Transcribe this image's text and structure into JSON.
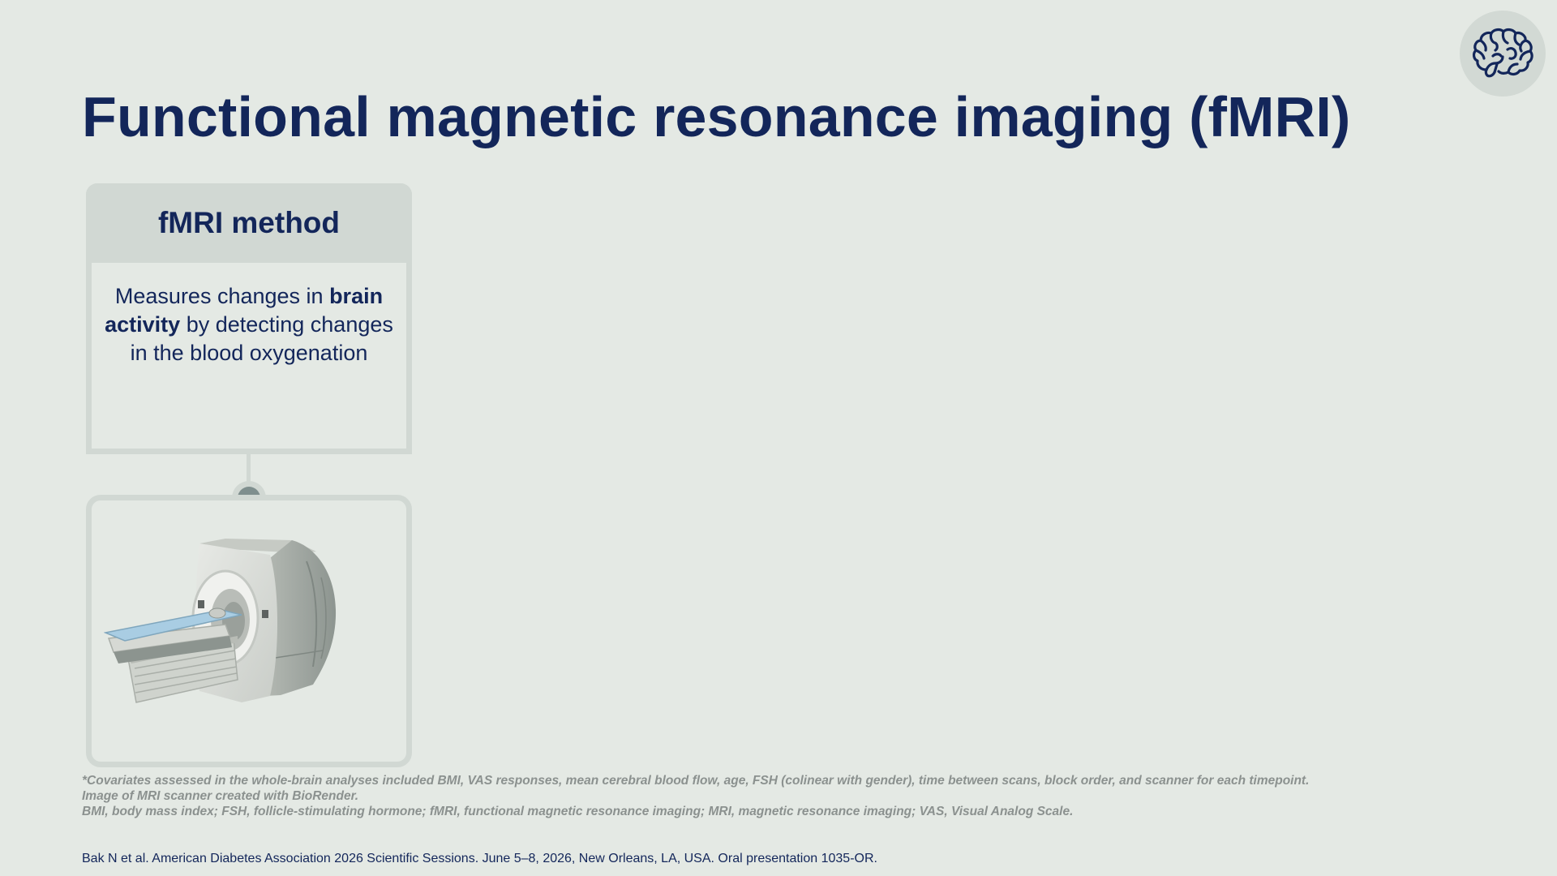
{
  "slide": {
    "title": "Functional magnetic resonance imaging (fMRI)",
    "corner_icon": "brain-icon"
  },
  "method_card": {
    "title": "fMRI method",
    "body_before": "Measures changes in ",
    "body_bold": "brain activity",
    "body_after": " by detecting changes in the blood oxygenation"
  },
  "image_card": {
    "image": "mri-scanner-illustration"
  },
  "footnotes": {
    "covariates": "*Covariates assessed in the whole-brain analyses included BMI, VAS responses, mean cerebral blood flow, age, FSH (colinear with gender), time between scans, block order, and scanner for each timepoint.",
    "image_credit": "Image of MRI scanner created with BioRender.",
    "abbreviations": "BMI, body mass index; FSH, follicle-stimulating hormone; fMRI, functional magnetic resonance imaging; MRI, magnetic resonance imaging; VAS, Visual Analog Scale."
  },
  "citation": "Bak N et al. American Diabetes Association 2026 Scientific Sessions. June 5–8, 2026, New Orleans, LA, USA. Oral presentation 1035-OR.",
  "colors": {
    "background": "#e4e9e4",
    "navy": "#13265a",
    "card_border": "#d1d8d3",
    "connector_dot": "#7f8f8e",
    "footnote_gray": "#8b918f",
    "scanner_bed": "#a9cde3"
  }
}
